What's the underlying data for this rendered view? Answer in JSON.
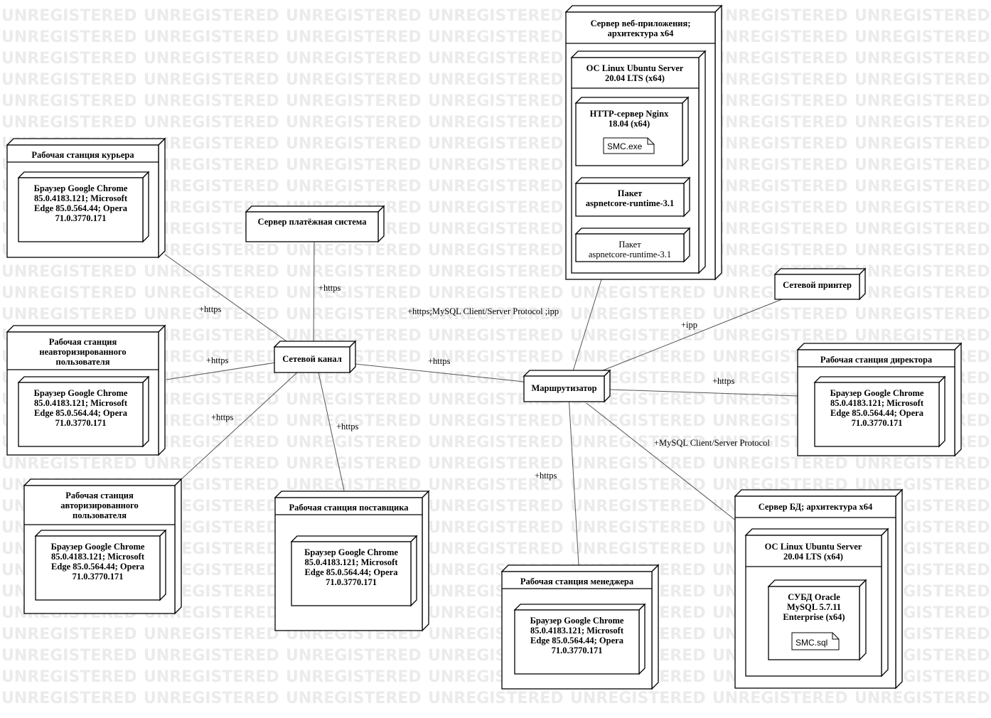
{
  "watermark": "UNREGISTERED",
  "nodes": {
    "courier": {
      "title": "Рабочая станция курьера",
      "inner": [
        "Браузер Google Chrome",
        "85.0.4183.121; Microsoft",
        "Edge 85.0.564.44; Opera",
        "71.0.3770.171"
      ]
    },
    "unauth": {
      "title": [
        "Рабочая станция",
        "неавторизированного",
        "пользователя"
      ],
      "inner": [
        "Браузер Google Chrome",
        "85.0.4183.121; Microsoft",
        "Edge 85.0.564.44; Opera",
        "71.0.3770.171"
      ]
    },
    "auth": {
      "title": [
        "Рабочая станция",
        "авторизированного",
        "пользователя"
      ],
      "inner": [
        "Браузер Google Chrome",
        "85.0.4183.121; Microsoft",
        "Edge 85.0.564.44; Opera",
        "71.0.3770.171"
      ]
    },
    "payment": {
      "title": "Сервер платёжная система"
    },
    "channel": {
      "title": "Сетевой канал"
    },
    "supplier": {
      "title": "Рабочая станция поставщика",
      "inner": [
        "Браузер Google Chrome",
        "85.0.4183.121; Microsoft",
        "Edge 85.0.564.44; Opera",
        "71.0.3770.171"
      ]
    },
    "webserver": {
      "title": [
        "Сервер веб-приложения;",
        "архитектура x64"
      ],
      "os": [
        "ОС Linux Ubuntu Server",
        "20.04 LTS (x64)"
      ],
      "nginx": [
        "HTTP-сервер Nginx",
        "18.04 (x64)"
      ],
      "artifact": "SMC.exe",
      "pkg1": [
        "Пакет",
        "aspnetcore-runtime-3.1"
      ],
      "pkg2": [
        "Пакет",
        "aspnetcore-runtime-3.1"
      ]
    },
    "router": {
      "title": "Маршрутизатор"
    },
    "printer": {
      "title": "Сетевой принтер"
    },
    "director": {
      "title": "Рабочая станция директора",
      "inner": [
        "Браузер Google Chrome",
        "85.0.4183.121; Microsoft",
        "Edge 85.0.564.44; Opera",
        "71.0.3770.171"
      ]
    },
    "manager": {
      "title": "Рабочая станция менеджера",
      "inner": [
        "Браузер Google Chrome",
        "85.0.4183.121; Microsoft",
        "Edge 85.0.564.44; Opera",
        "71.0.3770.171"
      ]
    },
    "dbserver": {
      "title": "Сервер БД; архитектура x64",
      "os": [
        "ОС Linux Ubuntu Server",
        "20.04 LTS (x64)"
      ],
      "dbms": [
        "СУБД Oracle",
        "MySQL 5.7.11",
        "Enterprise (x64)"
      ],
      "artifact": "SMC.sql"
    }
  },
  "edges": {
    "courier_channel": "+https",
    "payment_channel": "+https",
    "unauth_channel": "+https",
    "auth_channel": "+https",
    "supplier_channel": "+https",
    "channel_router": "+https",
    "router_web": "+https;MySQL Client/Server Protocol ;ipp",
    "router_printer": "+ipp",
    "router_director": "+https",
    "router_db": "+MySQL Client/Server Protocol",
    "router_manager": "+https"
  }
}
